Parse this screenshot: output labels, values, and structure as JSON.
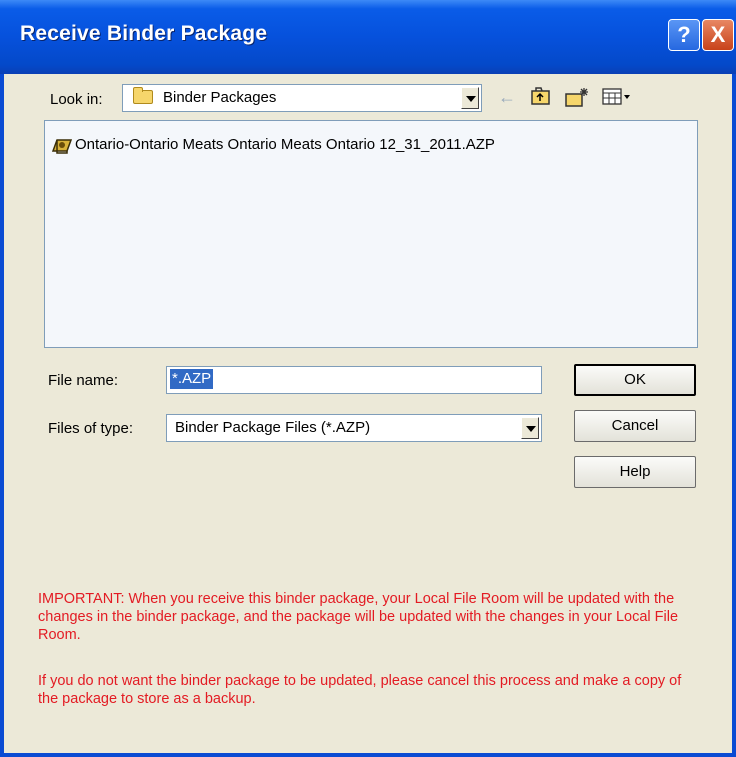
{
  "window": {
    "title": "Receive Binder Package",
    "help_label": "?",
    "close_label": "X"
  },
  "lookin": {
    "label": "Look in:",
    "value": "Binder Packages"
  },
  "toolbar": {
    "icons": [
      "back-arrow-icon",
      "up-folder-icon",
      "new-folder-icon",
      "view-menu-icon"
    ]
  },
  "files": [
    {
      "name": "Ontario-Ontario Meats Ontario Meats Ontario 12_31_2011.AZP",
      "icon": "binder-package-icon"
    }
  ],
  "filename": {
    "label": "File name:",
    "value": "*.AZP"
  },
  "filetype": {
    "label": "Files of type:",
    "value": "Binder Package Files (*.AZP)"
  },
  "buttons": {
    "ok": "OK",
    "cancel": "Cancel",
    "help": "Help"
  },
  "notice": {
    "important": "IMPORTANT:  When you receive this binder package, your Local File Room will be updated with the changes in the binder package, and the package will be updated with the changes in your Local File Room.",
    "cancel_advice": "If you do not want the binder package to be updated, please cancel this process and make a copy of the package to store as a backup."
  },
  "colors": {
    "titlebar": "#0a5ce8",
    "dialog_bg": "#ece9d8",
    "warning_text": "#e31b23",
    "selection": "#316ac5"
  }
}
